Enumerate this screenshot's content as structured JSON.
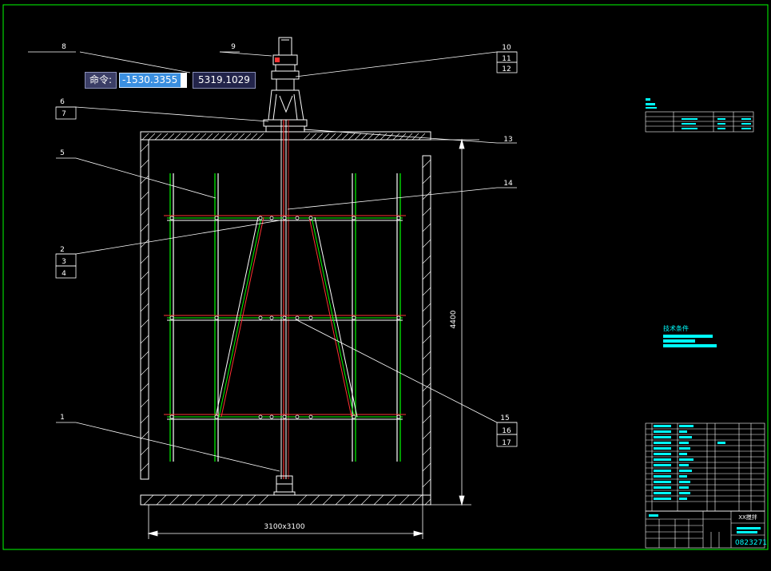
{
  "command_prompt": {
    "label": "命令:",
    "x_value": "-1530.3355",
    "y_value": "5319.1029"
  },
  "balloons": [
    "1",
    "2",
    "3",
    "4",
    "5",
    "6",
    "7",
    "8",
    "9",
    "10",
    "11",
    "12",
    "13",
    "14",
    "15",
    "16",
    "17"
  ],
  "dimensions": {
    "height": "4400",
    "width": "3100x3100"
  },
  "title_block": {
    "drawing_number": "0823271",
    "name": "XX搅拌"
  },
  "notes_heading": "技术条件",
  "colors": {
    "background": "#000000",
    "frame": "#00ff00",
    "lines": "#ffffff",
    "shaft": "#ff3333",
    "blade": "#00ff00",
    "table_text": "#00ffff"
  }
}
